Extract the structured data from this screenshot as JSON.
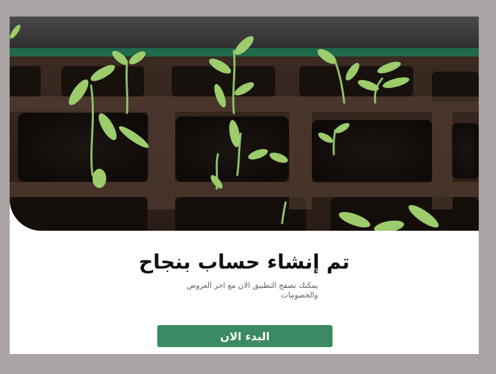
{
  "hero": {
    "image_subject": "seedlings-in-peat-tray"
  },
  "content": {
    "title": "تم إنشاء حساب بنجاح",
    "subtitle": "يمكنك تصفح التطبيق الان مع اخر العروض والخصومات"
  },
  "actions": {
    "start_label": "البدء الان"
  },
  "colors": {
    "page_background": "#a9a3a3",
    "card_background": "#ffffff",
    "primary_button": "#3b8a63",
    "title_text": "#111111",
    "subtitle_text": "#5f5f5f"
  }
}
